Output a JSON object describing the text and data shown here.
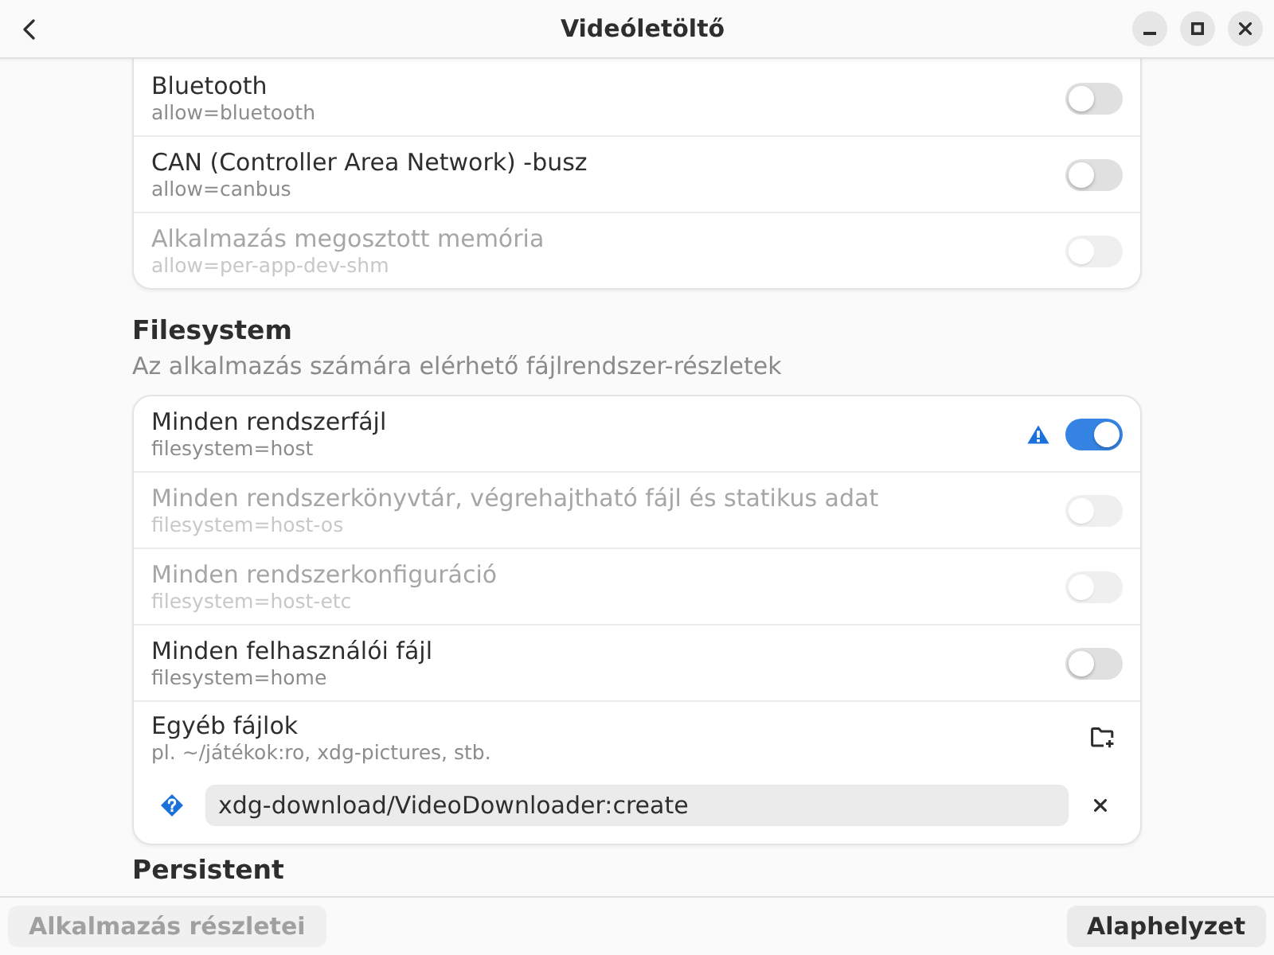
{
  "window": {
    "title": "Videóletöltő"
  },
  "sections": [
    {
      "rows": [
        {
          "kind": "switch",
          "title": "Bluetooth",
          "subtitle": "allow=bluetooth",
          "on": false,
          "disabled": false,
          "warning": false
        },
        {
          "kind": "switch",
          "title": "CAN (Controller Area Network) -busz",
          "subtitle": "allow=canbus",
          "on": false,
          "disabled": false,
          "warning": false
        },
        {
          "kind": "switch",
          "title": "Alkalmazás megosztott memória",
          "subtitle": "allow=per-app-dev-shm",
          "on": false,
          "disabled": true,
          "warning": false
        }
      ]
    },
    {
      "heading": "Filesystem",
      "description": "Az alkalmazás számára elérhető fájlrendszer-részletek",
      "rows": [
        {
          "kind": "switch",
          "title": "Minden rendszerfájl",
          "subtitle": "filesystem=host",
          "on": true,
          "disabled": false,
          "warning": true
        },
        {
          "kind": "switch",
          "title": "Minden rendszerkönyvtár, végrehajtható fájl és statikus adat",
          "subtitle": "filesystem=host-os",
          "on": false,
          "disabled": true,
          "warning": false
        },
        {
          "kind": "switch",
          "title": "Minden rendszerkonfiguráció",
          "subtitle": "filesystem=host-etc",
          "on": false,
          "disabled": true,
          "warning": false
        },
        {
          "kind": "switch",
          "title": "Minden felhasználói fájl",
          "subtitle": "filesystem=home",
          "on": false,
          "disabled": false,
          "warning": false
        },
        {
          "kind": "action",
          "title": "Egyéb fájlok",
          "subtitle": "pl. ~/játékok:ro, xdg-pictures, stb."
        },
        {
          "kind": "entry",
          "value": "xdg-download/VideoDownloader:create"
        }
      ]
    },
    {
      "heading": "Persistent"
    }
  ],
  "footer": {
    "buttons": [
      {
        "label": "Alkalmazás részletei",
        "disabled": true
      },
      {
        "label": "Alaphelyzet",
        "disabled": false
      }
    ]
  }
}
